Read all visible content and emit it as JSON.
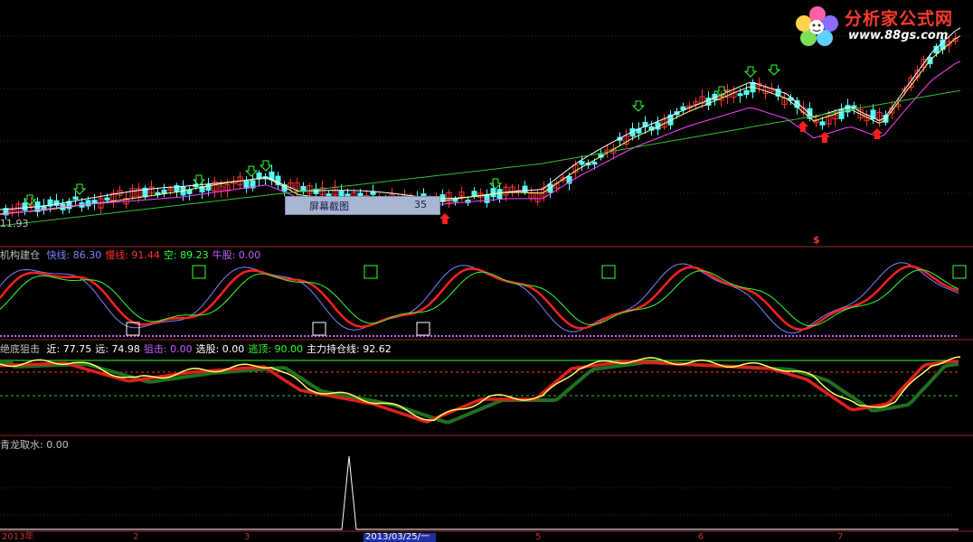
{
  "brand": {
    "title": "分析家公式网",
    "url": "www.88gs.com"
  },
  "tooltip": {
    "label": "屏幕截图",
    "value": "35"
  },
  "price_label": "11.93",
  "dollar_marker": "$",
  "panel1": {
    "name": "机构建仓",
    "items": [
      {
        "label": "快线:",
        "value": "86.30",
        "color": "#8080ff"
      },
      {
        "label": "慢线:",
        "value": "91.44",
        "color": "#ff3030"
      },
      {
        "label": "空:",
        "value": "89.23",
        "color": "#30ff30"
      },
      {
        "label": "牛股:",
        "value": "0.00",
        "color": "#c060ff"
      }
    ]
  },
  "panel2": {
    "name": "绝底狙击",
    "items": [
      {
        "label": "近:",
        "value": "77.75",
        "color": "#ffffff"
      },
      {
        "label": "远:",
        "value": "74.98",
        "color": "#ffffff"
      },
      {
        "label": "狙击:",
        "value": "0.00",
        "color": "#c060ff"
      },
      {
        "label": "选股:",
        "value": "0.00",
        "color": "#ffffff"
      },
      {
        "label": "逃顶:",
        "value": "90.00",
        "color": "#30ff30"
      },
      {
        "label": "主力持仓线:",
        "value": "92.62",
        "color": "#ffffff"
      }
    ]
  },
  "panel3": {
    "name": "青龙取水",
    "value": ": 0.00"
  },
  "x_axis": {
    "cursor_date": "2013/03/25/一",
    "ticks": [
      "2013年",
      "2",
      "3",
      "5",
      "6",
      "7"
    ]
  },
  "colors": {
    "up": "#ff3030",
    "down": "#54ffff",
    "ma_white": "#ffffff",
    "ma_yellow": "#ffff80",
    "ma_magenta": "#ff40ff",
    "ma_green": "#30c030",
    "divider": "#a02020"
  }
}
